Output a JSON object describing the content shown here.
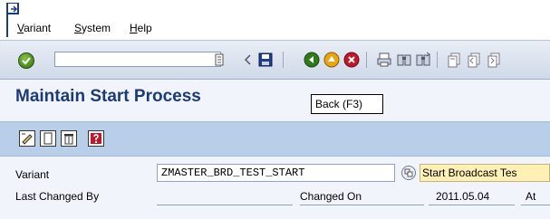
{
  "menubar": {
    "items": [
      {
        "label": "Variant",
        "key": "V"
      },
      {
        "label": "System",
        "key": "S"
      },
      {
        "label": "Help",
        "key": "H"
      }
    ]
  },
  "toolbar": {
    "command_value": "",
    "icons": [
      "enter-check-icon",
      "command-history-icon",
      "arrow-left-icon",
      "save-icon",
      "back-icon",
      "exit-icon",
      "cancel-icon",
      "print-icon",
      "find-icon",
      "find-next-icon",
      "first-page-icon",
      "previous-page-icon",
      "next-page-icon"
    ]
  },
  "page": {
    "title": "Maintain Start Process"
  },
  "tooltip": {
    "text": "Back  (F3)"
  },
  "app_toolbar": {
    "icons": [
      "edit-icon",
      "create-icon",
      "delete-icon",
      "help-icon"
    ]
  },
  "form": {
    "variant_label": "Variant",
    "variant_value": "ZMASTER_BRD_TEST_START",
    "variant_desc": "Start Broadcast Tes",
    "last_changed_label": "Last Changed By",
    "last_changed_value": "",
    "changed_on_label": "Changed On",
    "changed_on_value": "2011.05.04",
    "at_label": "At"
  },
  "colors": {
    "title": "#1c3b76",
    "app_toolbar": "#b9cfe9",
    "highlight_field": "#fff0b3"
  }
}
